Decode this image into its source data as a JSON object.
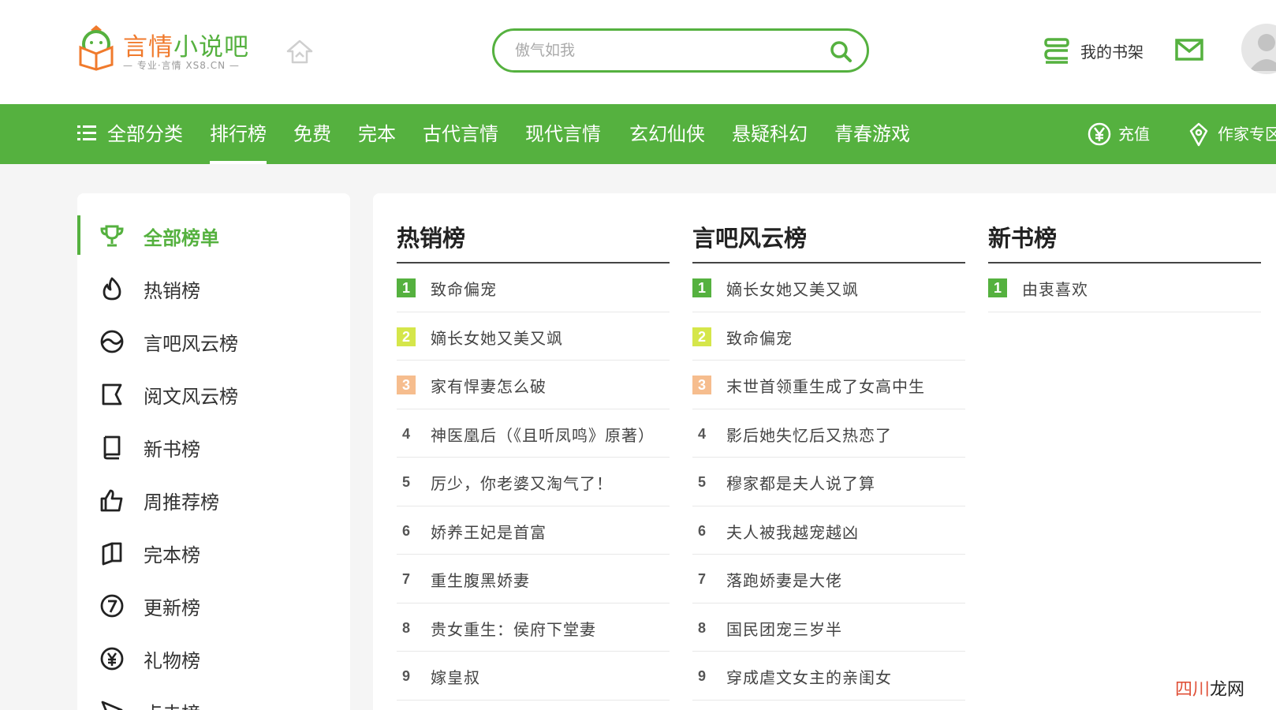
{
  "brand": {
    "name_accent": "言情",
    "name_rest": "小说吧",
    "subtitle": "— 专业·言情 XS8.CN —"
  },
  "search": {
    "placeholder": "傲气如我"
  },
  "header": {
    "shelf_label": "我的书架"
  },
  "nav": {
    "all_categories": "全部分类",
    "items": [
      "排行榜",
      "免费",
      "完本",
      "古代言情",
      "现代言情",
      "玄幻仙侠",
      "悬疑科幻",
      "青春游戏"
    ],
    "active_index": 0,
    "recharge": "充值",
    "author_zone": "作家专区"
  },
  "sidebar": {
    "items": [
      {
        "label": "全部榜单",
        "icon": "trophy-icon",
        "active": true
      },
      {
        "label": "热销榜",
        "icon": "flame-icon"
      },
      {
        "label": "言吧风云榜",
        "icon": "wave-circle-icon"
      },
      {
        "label": "阅文风云榜",
        "icon": "flag-icon"
      },
      {
        "label": "新书榜",
        "icon": "book-icon"
      },
      {
        "label": "周推荐榜",
        "icon": "thumbs-up-icon"
      },
      {
        "label": "完本榜",
        "icon": "open-book-icon"
      },
      {
        "label": "更新榜",
        "icon": "number-seven-icon"
      },
      {
        "label": "礼物榜",
        "icon": "yen-circle-icon"
      },
      {
        "label": "点击榜",
        "icon": "cursor-icon"
      }
    ]
  },
  "rankings": [
    {
      "title": "热销榜",
      "items": [
        "致命偏宠",
        "嫡长女她又美又飒",
        "家有悍妻怎么破",
        "神医凰后（《且听凤鸣》原著）",
        "厉少，你老婆又淘气了！",
        "娇养王妃是首富",
        "重生腹黑娇妻",
        "贵女重生：侯府下堂妻",
        "嫁皇叔"
      ]
    },
    {
      "title": "言吧风云榜",
      "items": [
        "嫡长女她又美又飒",
        "致命偏宠",
        "末世首领重生成了女高中生",
        "影后她失忆后又热恋了",
        "穆家都是夫人说了算",
        "夫人被我越宠越凶",
        "落跑娇妻是大佬",
        "国民团宠三岁半",
        "穿成虐文女主的亲闺女"
      ]
    },
    {
      "title": "新书榜",
      "items": [
        "由衷喜欢"
      ]
    }
  ],
  "watermark": {
    "accent": "四川",
    "rest": "龙网"
  },
  "colors": {
    "brand_green": "#55b13f",
    "rank2": "#d5e64a",
    "rank3": "#f6bd8e",
    "logo_orange": "#f07a2c"
  }
}
